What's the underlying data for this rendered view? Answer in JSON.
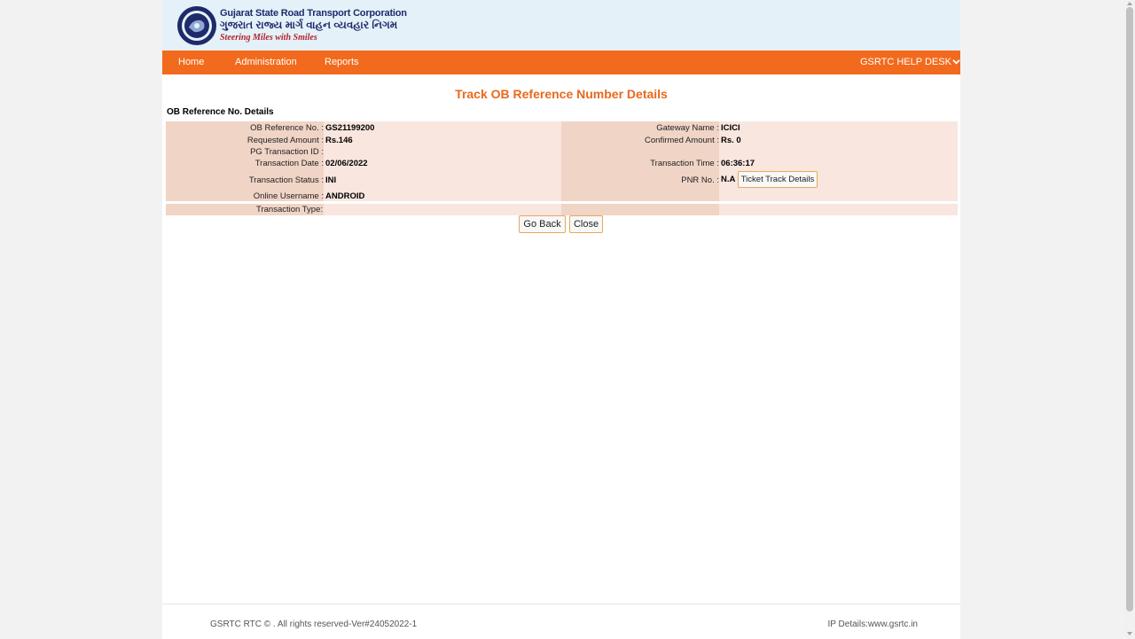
{
  "header": {
    "org_name_en": "Gujarat State Road Transport Corporation",
    "org_name_gu": "ગુજરાત રાજ્ય માર્ગ વાહન વ્યવહાર નિગમ",
    "tagline": "Steering Miles with Smiles"
  },
  "nav": {
    "home": "Home",
    "administration": "Administration",
    "reports": "Reports",
    "help_desk": "GSRTC HELP DESK"
  },
  "page": {
    "title": "Track OB Reference Number Details",
    "section_label": "OB Reference No. Details"
  },
  "details": {
    "ob_ref_label": "OB Reference No. :",
    "ob_ref_value": "GS21199200",
    "req_amount_label": "Requested Amount :",
    "req_amount_value": "Rs.146",
    "pg_txn_label": "PG Transaction ID :",
    "pg_txn_value": "",
    "txn_date_label": "Transaction Date :",
    "txn_date_value": "02/06/2022",
    "txn_status_label": "Transaction Status :",
    "txn_status_value": "INI",
    "online_user_label": "Online Username :",
    "online_user_value": "ANDROID",
    "gateway_label": "Gateway Name :",
    "gateway_value": "ICICI",
    "conf_amount_label": "Confirmed Amount :",
    "conf_amount_value": "Rs. 0",
    "txn_time_label": "Transaction Time :",
    "txn_time_value": "06:36:17",
    "pnr_label": "PNR No. :",
    "pnr_value": "N.A",
    "ticket_track_button": "Ticket Track Details",
    "txn_type_label": "Transaction Type:",
    "txn_type_value": ""
  },
  "actions": {
    "go_back": "Go Back",
    "close": "Close"
  },
  "footer": {
    "copyright": "GSRTC RTC © . All rights reserved-Ver#24052022-1",
    "ip_details": "IP Details:www.gsrtc.in"
  },
  "colors": {
    "nav_orange": "#f26a1d",
    "title_orange": "#e8691d",
    "header_blue": "#e4f1f9",
    "row_light": "#f8e6df",
    "row_dark": "#f0d4c6"
  }
}
